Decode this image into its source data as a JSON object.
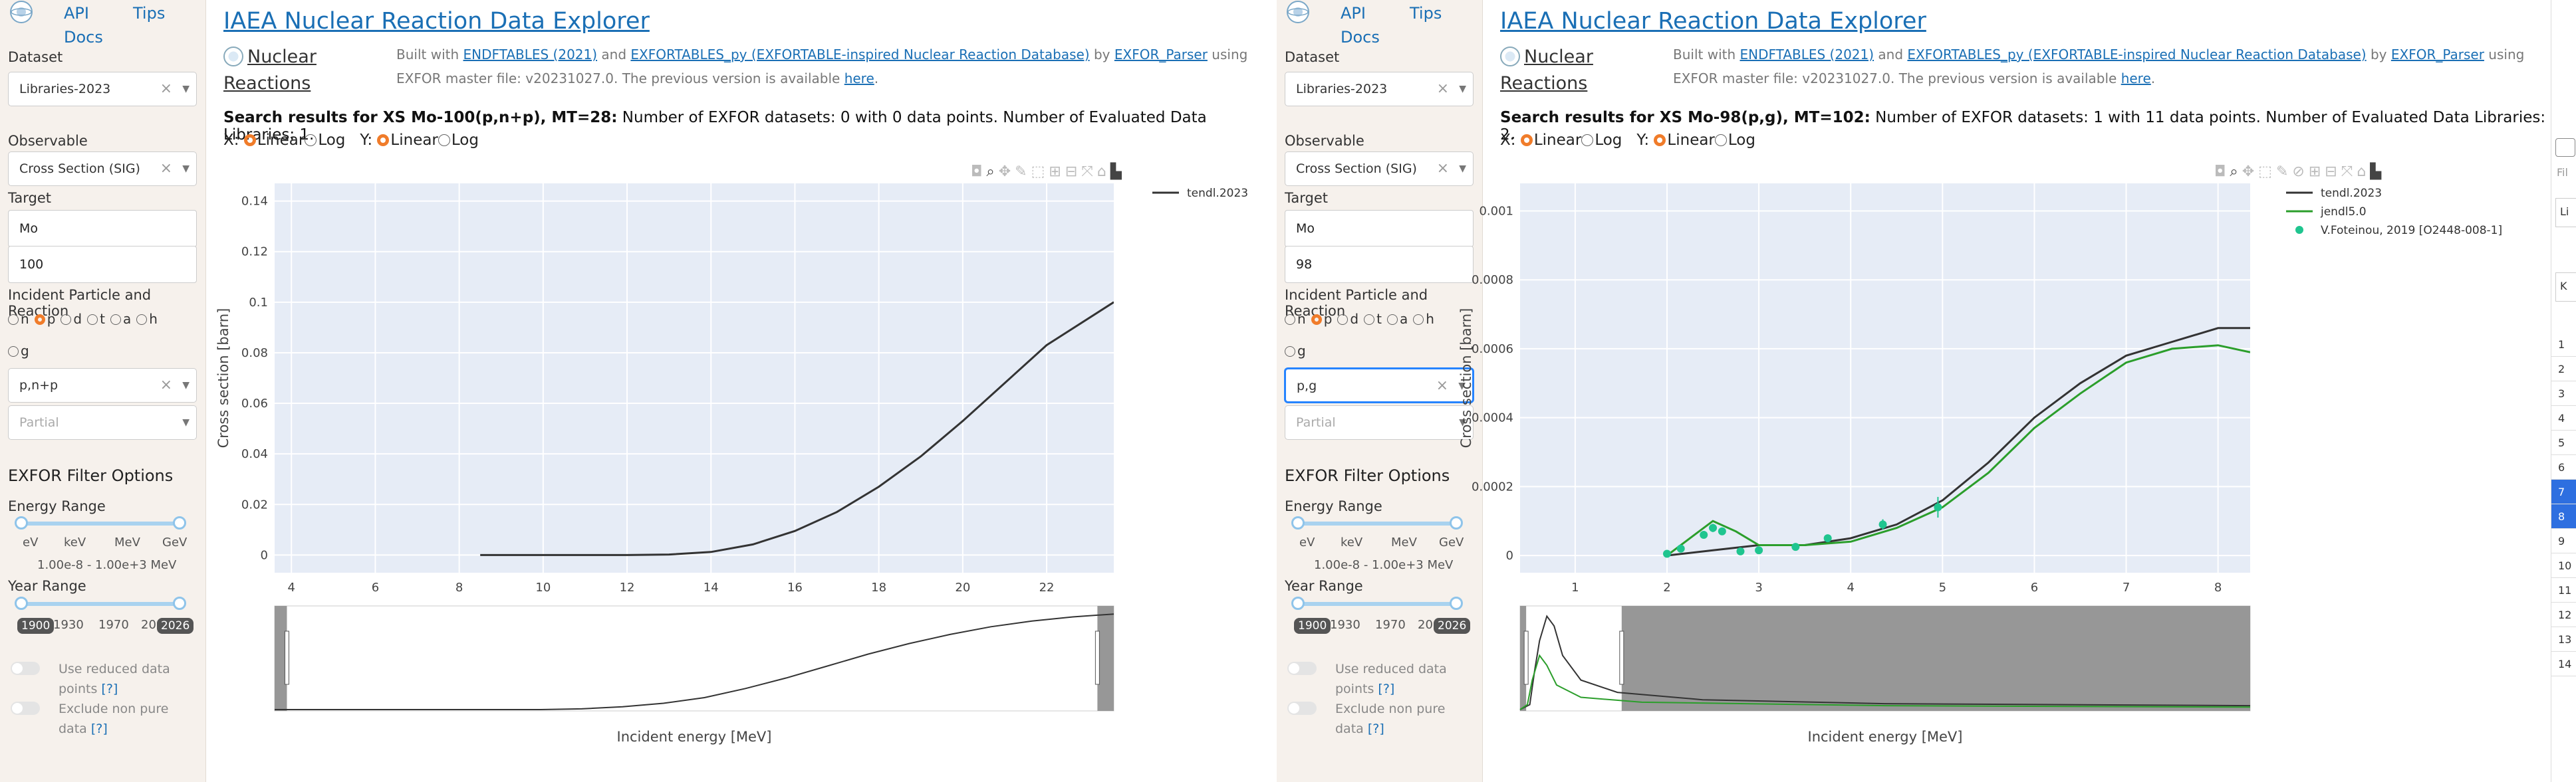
{
  "left": {
    "nav": {
      "api": "API",
      "docs": "Docs",
      "tips": "Tips"
    },
    "dataset_label": "Dataset",
    "dataset_value": "Libraries-2023",
    "observable_label": "Observable",
    "observable_value": "Cross Section (SIG)",
    "target_label": "Target",
    "target_element": "Mo",
    "target_mass": "100",
    "incident_label": "Incident Particle and Reaction",
    "particles": [
      "n",
      "p",
      "d",
      "t",
      "a",
      "h"
    ],
    "particle_g": "g",
    "selected_particle": "p",
    "reaction_value": "p,n+p",
    "partial_placeholder": "Partial",
    "exfor_heading": "EXFOR Filter Options",
    "energy_label": "Energy Range",
    "energy_marks": [
      "eV",
      "keV",
      "MeV",
      "GeV"
    ],
    "energy_range_text": "1.00e-8 - 1.00e+3 MeV",
    "year_label": "Year Range",
    "year_marks": [
      "1900",
      "1930",
      "1970",
      "20",
      "2026"
    ],
    "reduced_label": "Use reduced data points",
    "nonpure_label": "Exclude non pure data",
    "help": "[?]",
    "title": "IAEA Nuclear Reaction Data Explorer",
    "nr_label": "Nuclear Reactions",
    "built_prefix": "Built with",
    "built_link1": "ENDFTABLES (2021)",
    "built_and": "and",
    "built_link2": "EXFORTABLES_py (EXFORTABLE-inspired Nuclear Reaction Database)",
    "built_by": "by",
    "built_link3": "EXFOR_Parser",
    "built_using": "using EXFOR master file: v20231027.0. The previous version is available",
    "built_here": "here",
    "summary_bold": "Search results for XS Mo-100(p,n+p), MT=28:",
    "summary_rest": "Number of EXFOR datasets: 0 with 0 data points. Number of Evaluated Data Libraries: 1.",
    "axis_opts": {
      "x": "X:",
      "y": "Y:",
      "linear": "Linear",
      "log": "Log"
    },
    "xlabel": "Incident energy [MeV]",
    "ylabel": "Cross section [barn]"
  },
  "right": {
    "nav": {
      "api": "API",
      "docs": "Docs",
      "tips": "Tips"
    },
    "dataset_label": "Dataset",
    "dataset_value": "Libraries-2023",
    "observable_label": "Observable",
    "observable_value": "Cross Section (SIG)",
    "target_label": "Target",
    "target_element": "Mo",
    "target_mass": "98",
    "incident_label": "Incident Particle and Reaction",
    "particles": [
      "n",
      "p",
      "d",
      "t",
      "a",
      "h"
    ],
    "particle_g": "g",
    "selected_particle": "p",
    "reaction_value": "p,g",
    "partial_placeholder": "Partial",
    "exfor_heading": "EXFOR Filter Options",
    "energy_label": "Energy Range",
    "energy_marks": [
      "eV",
      "keV",
      "MeV",
      "GeV"
    ],
    "energy_range_text": "1.00e-8 - 1.00e+3 MeV",
    "year_label": "Year Range",
    "year_marks": [
      "1900",
      "1930",
      "1970",
      "20",
      "2026"
    ],
    "reduced_label": "Use reduced data points",
    "nonpure_label": "Exclude non pure data",
    "help": "[?]",
    "title": "IAEA Nuclear Reaction Data Explorer",
    "nr_label": "Nuclear Reactions",
    "built_prefix": "Built with",
    "built_link1": "ENDFTABLES (2021)",
    "built_and": "and",
    "built_link2": "EXFORTABLES_py (EXFORTABLE-inspired Nuclear Reaction Database)",
    "built_by": "by",
    "built_link3": "EXFOR_Parser",
    "built_using": "using EXFOR master file: v20231027.0. The previous version is available",
    "built_here": "here",
    "summary_bold": "Search results for XS Mo-98(p,g), MT=102:",
    "summary_rest": "Number of EXFOR datasets: 1 with 11 data points. Number of Evaluated Data Libraries: 2.",
    "axis_opts": {
      "x": "X:",
      "y": "Y:",
      "linear": "Linear",
      "log": "Log"
    },
    "xlabel": "Incident energy [MeV]",
    "ylabel": "Cross section [barn]"
  },
  "edge_rows": [
    "1",
    "2",
    "3",
    "4",
    "5",
    "6",
    "7",
    "8",
    "9",
    "10",
    "11",
    "12",
    "13",
    "14"
  ],
  "edge_inputs": [
    "Fil",
    "Li",
    "K"
  ],
  "chart_data": [
    {
      "type": "line",
      "xlabel": "Incident energy [MeV]",
      "ylabel": "Cross section [barn]",
      "xlim": [
        3.6,
        23.6
      ],
      "ylim": [
        -0.007,
        0.147
      ],
      "xticks": [
        4,
        6,
        8,
        10,
        12,
        14,
        16,
        18,
        20,
        22
      ],
      "yticks": [
        0,
        0.02,
        0.04,
        0.06,
        0.08,
        0.1,
        0.12,
        0.14
      ],
      "legend_position": "top-right",
      "series": [
        {
          "name": "tendl.2023",
          "color": "#333333",
          "x": [
            8.5,
            10,
            12,
            13,
            14,
            15,
            16,
            17,
            18,
            19,
            20,
            21,
            22,
            23.6
          ],
          "y": [
            0,
            0,
            0,
            0.0002,
            0.0012,
            0.0042,
            0.0095,
            0.017,
            0.027,
            0.039,
            0.053,
            0.068,
            0.083,
            0.1
          ]
        }
      ]
    },
    {
      "type": "line",
      "xlabel": "Incident energy [MeV]",
      "ylabel": "Cross section [barn]",
      "xlim": [
        0.4,
        8.35
      ],
      "ylim": [
        -5e-05,
        0.00108
      ],
      "xticks": [
        1,
        2,
        3,
        4,
        5,
        6,
        7,
        8
      ],
      "yticks": [
        0,
        0.0002,
        0.0004,
        0.0006,
        0.0008,
        0.001
      ],
      "legend_position": "top-right",
      "series": [
        {
          "name": "tendl.2023",
          "color": "#333333",
          "x": [
            2,
            2.5,
            3,
            3.5,
            4,
            4.5,
            5,
            5.5,
            6,
            6.5,
            7,
            7.5,
            8,
            8.35
          ],
          "y": [
            0,
            1.5e-05,
            3e-05,
            3e-05,
            5e-05,
            9e-05,
            0.00016,
            0.00027,
            0.0004,
            0.0005,
            0.00058,
            0.00062,
            0.00066,
            0.00066
          ]
        },
        {
          "name": "jendl5.0",
          "color": "#2b9e2b",
          "x": [
            2,
            2.25,
            2.5,
            2.75,
            3,
            3.5,
            4,
            4.5,
            5,
            5.5,
            6,
            6.5,
            7,
            7.5,
            8,
            8.35
          ],
          "y": [
            0,
            5e-05,
            0.0001,
            7e-05,
            3e-05,
            3e-05,
            4e-05,
            8e-05,
            0.00014,
            0.00024,
            0.00037,
            0.00047,
            0.00056,
            0.0006,
            0.00061,
            0.00059
          ]
        },
        {
          "name": "V.Foteinou, 2019 [O2448-008-1]",
          "color": "#1fc58f",
          "marker": "circle",
          "x": [
            2.0,
            2.15,
            2.4,
            2.5,
            2.6,
            2.8,
            3.0,
            3.4,
            3.75,
            4.35,
            4.95
          ],
          "y": [
            5e-06,
            2e-05,
            6e-05,
            8e-05,
            7e-05,
            1.2e-05,
            1.5e-05,
            2.5e-05,
            5e-05,
            9e-05,
            0.00014
          ],
          "err": [
            0,
            0,
            8e-06,
            1.2e-05,
            1e-05,
            0,
            0,
            0,
            8e-06,
            1.5e-05,
            3e-05
          ]
        }
      ]
    }
  ]
}
